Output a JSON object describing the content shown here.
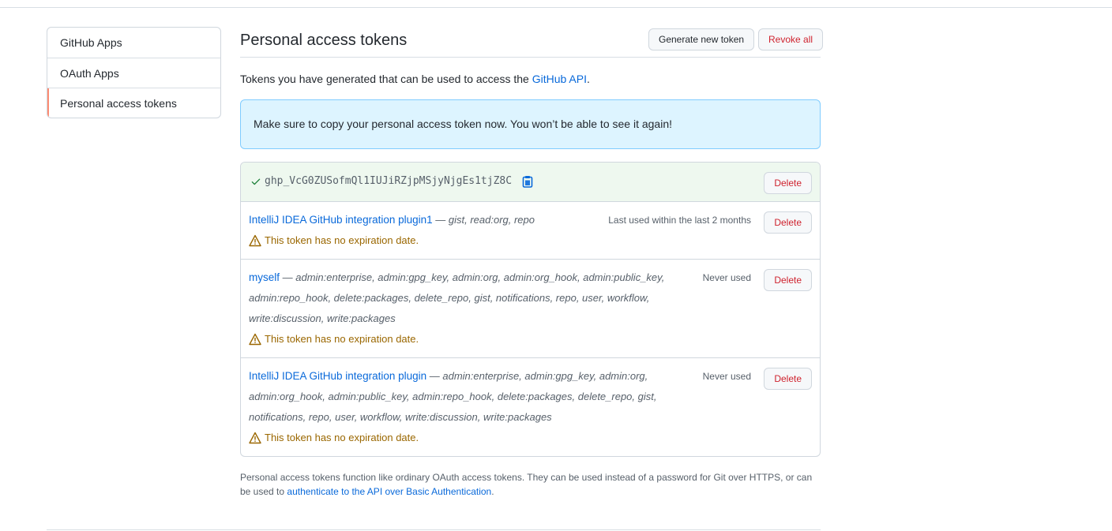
{
  "sidebar": {
    "items": [
      {
        "label": "GitHub Apps"
      },
      {
        "label": "OAuth Apps"
      },
      {
        "label": "Personal access tokens"
      }
    ]
  },
  "header": {
    "title": "Personal access tokens",
    "generate_label": "Generate new token",
    "revoke_label": "Revoke all"
  },
  "intro": {
    "text": "Tokens you have generated that can be used to access the ",
    "link": "GitHub API",
    "suffix": "."
  },
  "flash": {
    "message": "Make sure to copy your personal access token now. You won’t be able to see it again!"
  },
  "new_token": {
    "value": "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",
    "delete_label": "Delete"
  },
  "tokens": [
    {
      "name": "IntelliJ IDEA GitHub integration plugin1",
      "dash": " — ",
      "scopes": "gist, read:org, repo",
      "last_used": "Last used within the last 2 months",
      "warning": "This token has no expiration date.",
      "delete_label": "Delete"
    },
    {
      "name": "myself",
      "dash": " — ",
      "scopes": "admin:enterprise, admin:gpg_key, admin:org, admin:org_hook, admin:public_key, admin:repo_hook, delete:packages, delete_repo, gist, notifications, repo, user, workflow, write:discussion, write:packages",
      "last_used": "Never used",
      "warning": "This token has no expiration date.",
      "delete_label": "Delete"
    },
    {
      "name": "IntelliJ IDEA GitHub integration plugin",
      "dash": " — ",
      "scopes": "admin:enterprise, admin:gpg_key, admin:org, admin:org_hook, admin:public_key, admin:repo_hook, delete:packages, delete_repo, gist, notifications, repo, user, workflow, write:discussion, write:packages",
      "last_used": "Never used",
      "warning": "This token has no expiration date.",
      "delete_label": "Delete"
    }
  ],
  "footnote": {
    "text": "Personal access tokens function like ordinary OAuth access tokens. They can be used instead of a password for Git over HTTPS, or can be used to ",
    "link": "authenticate to the API over Basic Authentication",
    "suffix": "."
  },
  "colors": {
    "accent": "#0969da",
    "danger": "#cf222e",
    "warning": "#9a6700",
    "success": "#1a7f37",
    "flash_bg": "#ddf4ff",
    "selected_marker": "#fd8c73"
  },
  "icons": {
    "check": "check-icon",
    "copy": "clipboard-icon",
    "warning": "alert-triangle-icon"
  }
}
